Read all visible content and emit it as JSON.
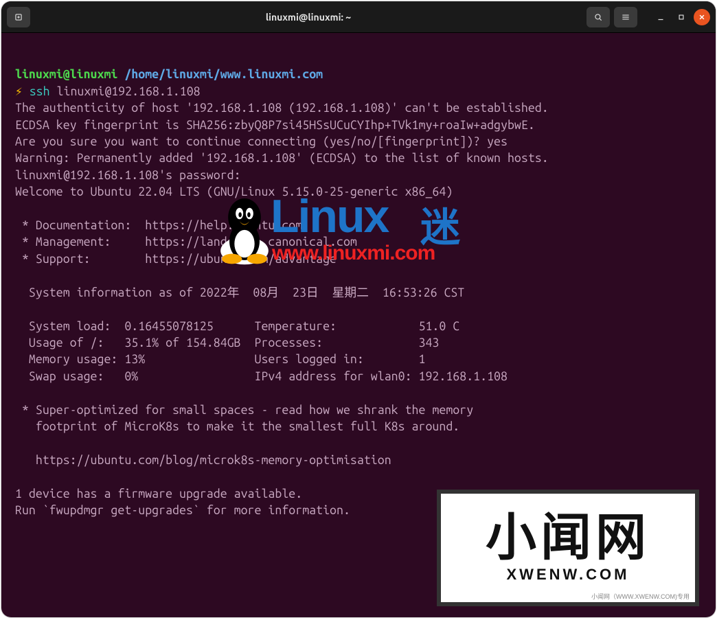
{
  "window": {
    "title": "linuxmi@linuxmi: ~"
  },
  "prompt": {
    "user_host": "linuxmi@linuxmi",
    "path": "/home/linuxmi/www.linuxmi.com",
    "symbol": "⚡",
    "command": "ssh",
    "argument": "linuxmi@192.168.1.108"
  },
  "lines": {
    "l1": "The authenticity of host '192.168.1.108 (192.168.1.108)' can't be established.",
    "l2": "ECDSA key fingerprint is SHA256:zbyQ8P7si45HSsUCuCYIhp+TVk1my+roaIw+adgybwE.",
    "l3": "Are you sure you want to continue connecting (yes/no/[fingerprint])? yes",
    "l4": "Warning: Permanently added '192.168.1.108' (ECDSA) to the list of known hosts.",
    "l5": "linuxmi@192.168.1.108's password:",
    "l6": "Welcome to Ubuntu 22.04 LTS (GNU/Linux 5.15.0-25-generic x86_64)",
    "blank": "",
    "doc": " * Documentation:  https://help.ubuntu.com",
    "mgmt": " * Management:     https://landscape.canonical.com",
    "sup": " * Support:        https://ubuntu.com/advantage",
    "sysinfo_hdr": "  System information as of 2022年  08月  23日  星期二  16:53:26 CST",
    "row1": "  System load:  0.16455078125      Temperature:            51.0 C",
    "row2": "  Usage of /:   35.1% of 154.84GB  Processes:              343",
    "row3": "  Memory usage: 13%                Users logged in:        1",
    "row4": "  Swap usage:   0%                 IPv4 address for wlan0: 192.168.1.108",
    "opt1": " * Super-optimized for small spaces - read how we shrank the memory",
    "opt2": "   footprint of MicroK8s to make it the smallest full K8s around.",
    "opt3": "   https://ubuntu.com/blog/microk8s-memory-optimisation",
    "fw1": "1 device has a firmware upgrade available.",
    "fw2": "Run `fwupdmgr get-upgrades` for more information."
  },
  "overlay_linux": {
    "word": "Linux",
    "cn": "迷",
    "url": "www.linuxmi.com"
  },
  "overlay_xwenw": {
    "cn": "小闻网",
    "en": "XWENW.COM",
    "sub": "小闻网（WWW.XWENW.COM)专用"
  }
}
